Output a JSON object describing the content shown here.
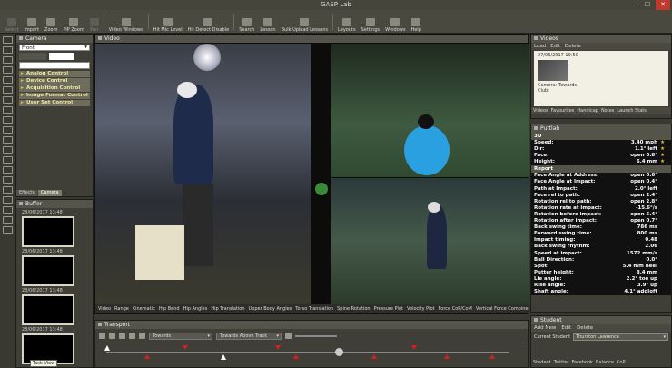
{
  "title": "GASP Lab",
  "toolbar": [
    {
      "name": "select",
      "label": "Select",
      "enabled": false
    },
    {
      "name": "import",
      "label": "Import",
      "enabled": true
    },
    {
      "name": "zoom",
      "label": "Zoom",
      "enabled": true
    },
    {
      "name": "pip-zoom",
      "label": "PiP Zoom",
      "enabled": true
    },
    {
      "name": "pan",
      "label": "Pan",
      "enabled": false
    },
    {
      "name": "video-windows",
      "label": "Video Windows",
      "enabled": true
    },
    {
      "name": "hit-mic-level",
      "label": "Hit Mic Level",
      "enabled": true
    },
    {
      "name": "hit-detect-disable",
      "label": "Hit Detect Disable",
      "enabled": true
    },
    {
      "name": "search",
      "label": "Search",
      "enabled": true
    },
    {
      "name": "lesson",
      "label": "Lesson",
      "enabled": true
    },
    {
      "name": "bulk-upload-lessons",
      "label": "Bulk Upload Lessons",
      "enabled": true
    },
    {
      "name": "layouts",
      "label": "Layouts",
      "enabled": true
    },
    {
      "name": "settings",
      "label": "Settings",
      "enabled": true
    },
    {
      "name": "windows",
      "label": "Windows",
      "enabled": true
    },
    {
      "name": "help",
      "label": "Help",
      "enabled": true
    }
  ],
  "camera": {
    "title": "Camera",
    "selected": "Front",
    "controls": [
      "Analog Control",
      "Device Control",
      "Acquisition Control",
      "Image Format Control",
      "User Set Control"
    ],
    "tabs": [
      "Effects",
      "Camera"
    ]
  },
  "buffer": {
    "title": "Buffer",
    "items": [
      "28/06/2017 13:48",
      "28/06/2017 13:48",
      "28/06/2017 13:48",
      "28/06/2017 13:48"
    ]
  },
  "video": {
    "title": "Video",
    "metrics": [
      "Video",
      "Range",
      "Kinematic",
      "Hip Bend",
      "Hip Angles",
      "Hip Translation",
      "Upper Body Angles",
      "Torso Translation",
      "Spine Rotation",
      "Pressure Plot",
      "Velocity Plot",
      "Force CoP/CoM",
      "Vertical Force Combined",
      "Vertical Force Left"
    ]
  },
  "transport": {
    "title": "Transport",
    "direction": "Towards",
    "track": "Towards Above Track"
  },
  "videos": {
    "title": "Videos",
    "actions": [
      "Load",
      "Edit",
      "Delete"
    ],
    "entry_date": "27/06/2017 19:50",
    "entry_camera": "Camera: Towards",
    "entry_club": "Club:",
    "tabs": [
      "Videos",
      "Favourites",
      "Handicap",
      "Notes",
      "Launch Stats"
    ]
  },
  "puttlab": {
    "title": "Puttlab",
    "section_3d": "3D",
    "rows_3d": [
      {
        "label": "Speed:",
        "value": "3.40 mph"
      },
      {
        "label": "Dir:",
        "value": "1.1° left"
      },
      {
        "label": "Face:",
        "value": "open 0.8°"
      },
      {
        "label": "Height:",
        "value": "6.4 mm"
      }
    ],
    "section_report": "Report",
    "rows_report": [
      {
        "label": "Face Angle at Address:",
        "value": "open 0.6°"
      },
      {
        "label": "Face Angle at Impact:",
        "value": "open 0.4°"
      },
      {
        "label": "Path at Impact:",
        "value": "2.0° left"
      },
      {
        "label": "Face rel to path:",
        "value": "open 2.4°"
      },
      {
        "label": "Rotation rel to path:",
        "value": "open 2.8°"
      },
      {
        "label": "Rotation rate at impact:",
        "value": "-15.6°/s"
      },
      {
        "label": "Rotation before impact:",
        "value": "open 5.4°"
      },
      {
        "label": "Rotation after impact:",
        "value": "open 0.7°"
      },
      {
        "label": "Back swing time:",
        "value": "786 ms"
      },
      {
        "label": "Forward swing time:",
        "value": "800 ms"
      },
      {
        "label": "Impact timing:",
        "value": "0.48"
      },
      {
        "label": "Back swing rhythm:",
        "value": "2.06"
      },
      {
        "label": "Speed at impact:",
        "value": "1572 mm/s"
      },
      {
        "label": "Ball Direction:",
        "value": "0.0°"
      },
      {
        "label": "Spot:",
        "value": "5.4 mm heel"
      },
      {
        "label": "Putter height:",
        "value": "8.4 mm"
      },
      {
        "label": "Lie angle:",
        "value": "2.2° toe up"
      },
      {
        "label": "Rise angle:",
        "value": "3.9° up"
      },
      {
        "label": "Shaft angle:",
        "value": "4.1° addloft"
      }
    ]
  },
  "student": {
    "title": "Student",
    "actions": [
      "Add New",
      "Edit",
      "Delete"
    ],
    "current_label": "Current Student",
    "current": "Thurston Lawrence",
    "tabs": [
      "Student",
      "Twitter",
      "Facebook",
      "Balance",
      "CoP"
    ]
  },
  "tooltip": "Task View",
  "colors": {
    "accent": "#f0c030",
    "marker": "#d62020",
    "panel": "#403f37"
  }
}
